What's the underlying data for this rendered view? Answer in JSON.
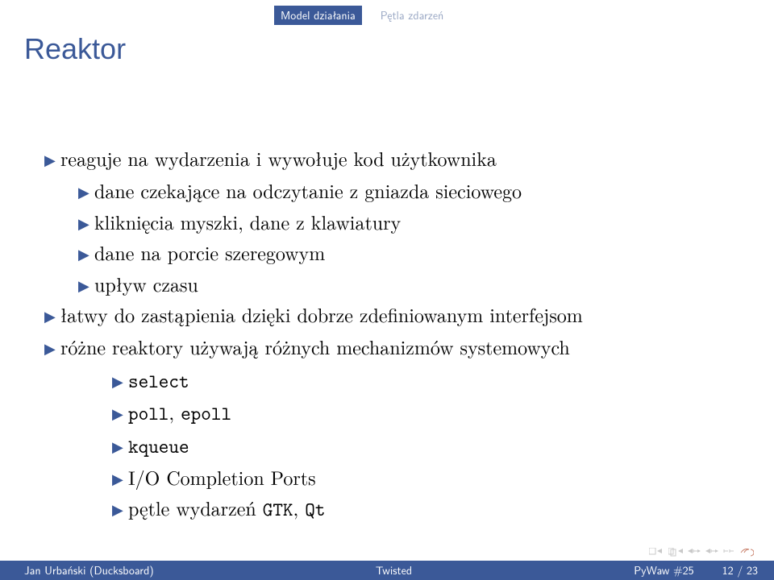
{
  "header": {
    "section": "Model działania",
    "subsection": "Pętla zdarzeń"
  },
  "title": "Reaktor",
  "bullets": {
    "b1": "reaguje na wydarzenia i wywołuje kod użytkownika",
    "b1_1": "dane czekające na odczytanie z gniazda sieciowego",
    "b1_2": "kliknięcia myszki, dane z klawiatury",
    "b1_3": "dane na porcie szeregowym",
    "b1_4": "upływ czasu",
    "b2": "łatwy do zastąpienia dzięki dobrze zdefiniowanym interfejsom",
    "b3": "różne reaktory używają różnych mechanizmów systemowych",
    "b3_1": "select",
    "b3_2a": "poll",
    "b3_2b": "epoll",
    "b3_3": "kqueue",
    "b3_4": "I/O Completion Ports",
    "b3_5a": "pętle wydarzeń ",
    "b3_5b": "GTK",
    "b3_5c": "Qt"
  },
  "footer": {
    "author": "Jan Urbański (Ducksboard)",
    "talk": "Twisted",
    "event": "PyWaw #25",
    "page_current": "12",
    "page_sep": " / ",
    "page_total": "23"
  }
}
